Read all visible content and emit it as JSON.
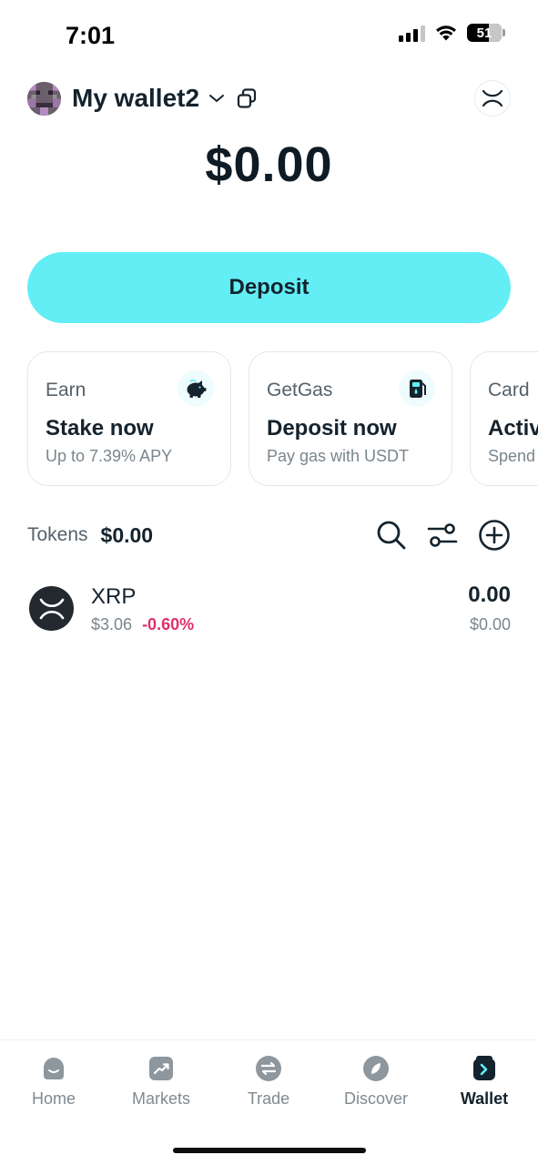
{
  "status_bar": {
    "time": "7:01",
    "battery": "51"
  },
  "header": {
    "wallet_name": "My wallet2"
  },
  "balance": "$0.00",
  "deposit_label": "Deposit",
  "cards": [
    {
      "label": "Earn",
      "title": "Stake now",
      "subtitle": "Up to 7.39% APY",
      "icon": "piggy-bank-icon"
    },
    {
      "label": "GetGas",
      "title": "Deposit now",
      "subtitle": "Pay gas with USDT",
      "icon": "fuel-pump-icon"
    },
    {
      "label": "Card",
      "title": "Activ",
      "subtitle": "Spend"
    }
  ],
  "tokens": {
    "label": "Tokens",
    "total": "$0.00",
    "items": [
      {
        "symbol": "XRP",
        "price": "$3.06",
        "change": "-0.60%",
        "amount": "0.00",
        "value": "$0.00"
      }
    ]
  },
  "tabs": [
    {
      "label": "Home",
      "icon": "home-icon"
    },
    {
      "label": "Markets",
      "icon": "trend-up-icon"
    },
    {
      "label": "Trade",
      "icon": "swap-icon"
    },
    {
      "label": "Discover",
      "icon": "compass-icon"
    },
    {
      "label": "Wallet",
      "icon": "wallet-icon",
      "active": true
    }
  ],
  "colors": {
    "accent": "#63eef6",
    "negative": "#e0306a",
    "text": "#14232d",
    "muted": "#7a858c"
  }
}
